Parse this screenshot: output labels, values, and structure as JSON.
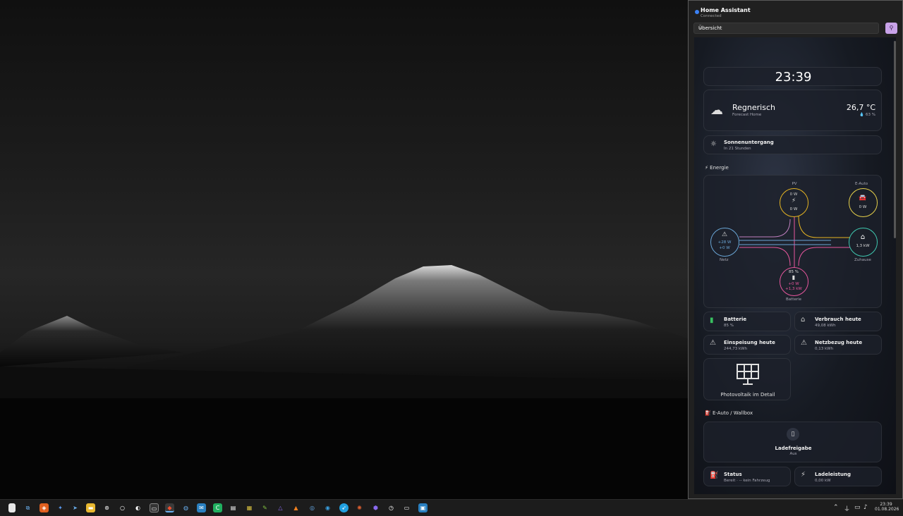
{
  "panel": {
    "title": "Home Assistant",
    "status": "Connected",
    "view_select": "Übersicht"
  },
  "clock": {
    "time": "23:39"
  },
  "weather": {
    "condition": "Regnerisch",
    "source": "Forecast Home",
    "temperature": "26,7 °C",
    "humidity": "63 %"
  },
  "sun": {
    "label": "Sonnenuntergang",
    "sub": "In 21 Stunden"
  },
  "energy": {
    "section_title": "Energie",
    "pv": {
      "label": "PV",
      "top": "0 W",
      "bottom": "0 W"
    },
    "car": {
      "label": "E-Auto",
      "value": "0 W"
    },
    "grid": {
      "label": "Netz",
      "line1": "+28 W",
      "line2": "+0 W"
    },
    "home": {
      "label": "Zuhause",
      "value": "1,3 kW"
    },
    "battery": {
      "label": "Batterie",
      "soc": "85 %",
      "line1": "+0 W",
      "line2": "+1,3 kW"
    }
  },
  "tiles": [
    {
      "title": "Batterie",
      "value": "85 %"
    },
    {
      "title": "Verbrauch heute",
      "value": "49,08 kWh"
    },
    {
      "title": "Einspeisung heute",
      "value": "244,73 kWh"
    },
    {
      "title": "Netzbezug heute",
      "value": "0,13 kWh"
    }
  ],
  "pv_detail": {
    "label": "Photovoltaik im Detail"
  },
  "ev": {
    "section_title": "E-Auto / Wallbox",
    "charge_label": "Ladefreigabe",
    "charge_state": "Aus",
    "status_title": "Status",
    "status_value": "Bereit · -- kein Fahrzeug",
    "power_title": "Ladeleistung",
    "power_value": "0,00 kW"
  },
  "taskbar": {
    "time": "23:39",
    "date": "01.08.2026"
  },
  "colors": {
    "accent": "#3b82f6",
    "pv": "#e6b422",
    "car": "#e6d04a",
    "grid": "#6aa6d6",
    "home": "#3fc8b0",
    "battery": "#e8579e",
    "pin": "#c8a2e8"
  }
}
